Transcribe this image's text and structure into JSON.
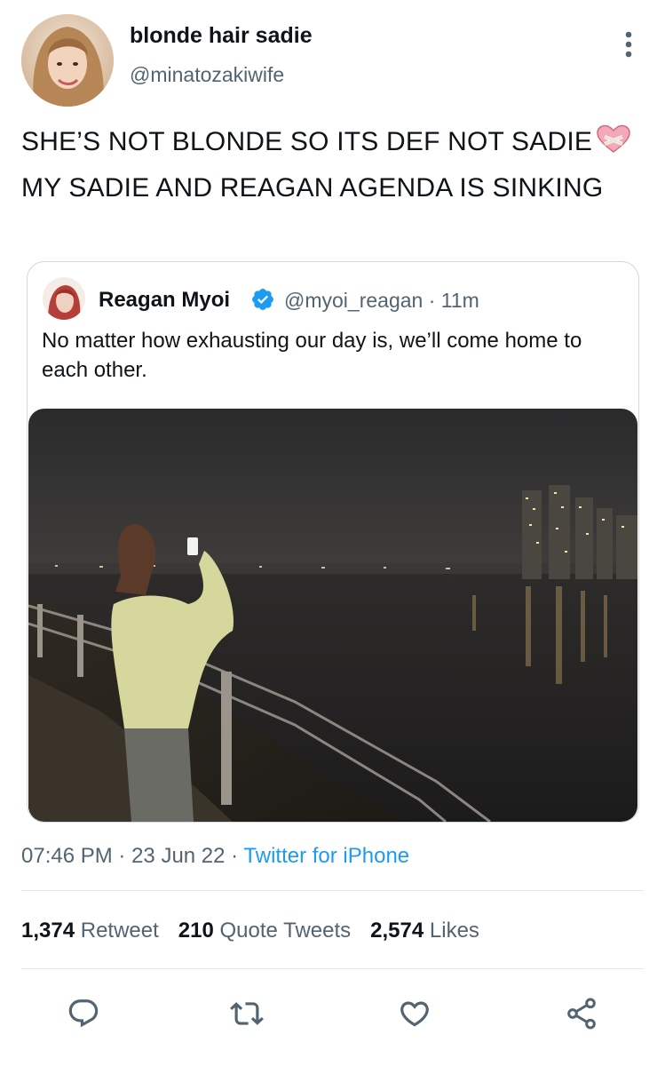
{
  "tweet": {
    "author": {
      "display_name": "blonde hair sadie",
      "handle": "@minatozakiwife"
    },
    "text_part1": "SHE’S NOT BLONDE SO ITS DEF NOT SADIE",
    "text_emoji": "mending-heart-icon",
    "text_part2": "MY SADIE AND REAGAN AGENDA IS SINKING",
    "quoted": {
      "display_name": "Reagan Myoi",
      "verified": true,
      "handle": "@myoi_reagan",
      "separator": "·",
      "time_ago": "11m",
      "text": "No matter how exhausting our day is, we’ll come home to each other."
    },
    "timestamp": {
      "time": "07:46 PM",
      "separator": "·",
      "date": "23 Jun 22",
      "source": "Twitter for iPhone"
    },
    "stats": {
      "retweets_count": "1,374",
      "retweets_label": "Retweet",
      "quotes_count": "210",
      "quotes_label": "Quote Tweets",
      "likes_count": "2,574",
      "likes_label": "Likes"
    },
    "actions": [
      "reply-icon",
      "retweet-icon",
      "like-icon",
      "share-icon"
    ]
  },
  "colors": {
    "text_primary": "#0f1419",
    "text_secondary": "#536471",
    "link_blue": "#1d9bf0",
    "verified_blue": "#1d9bf0",
    "border": "#cfd9de"
  }
}
